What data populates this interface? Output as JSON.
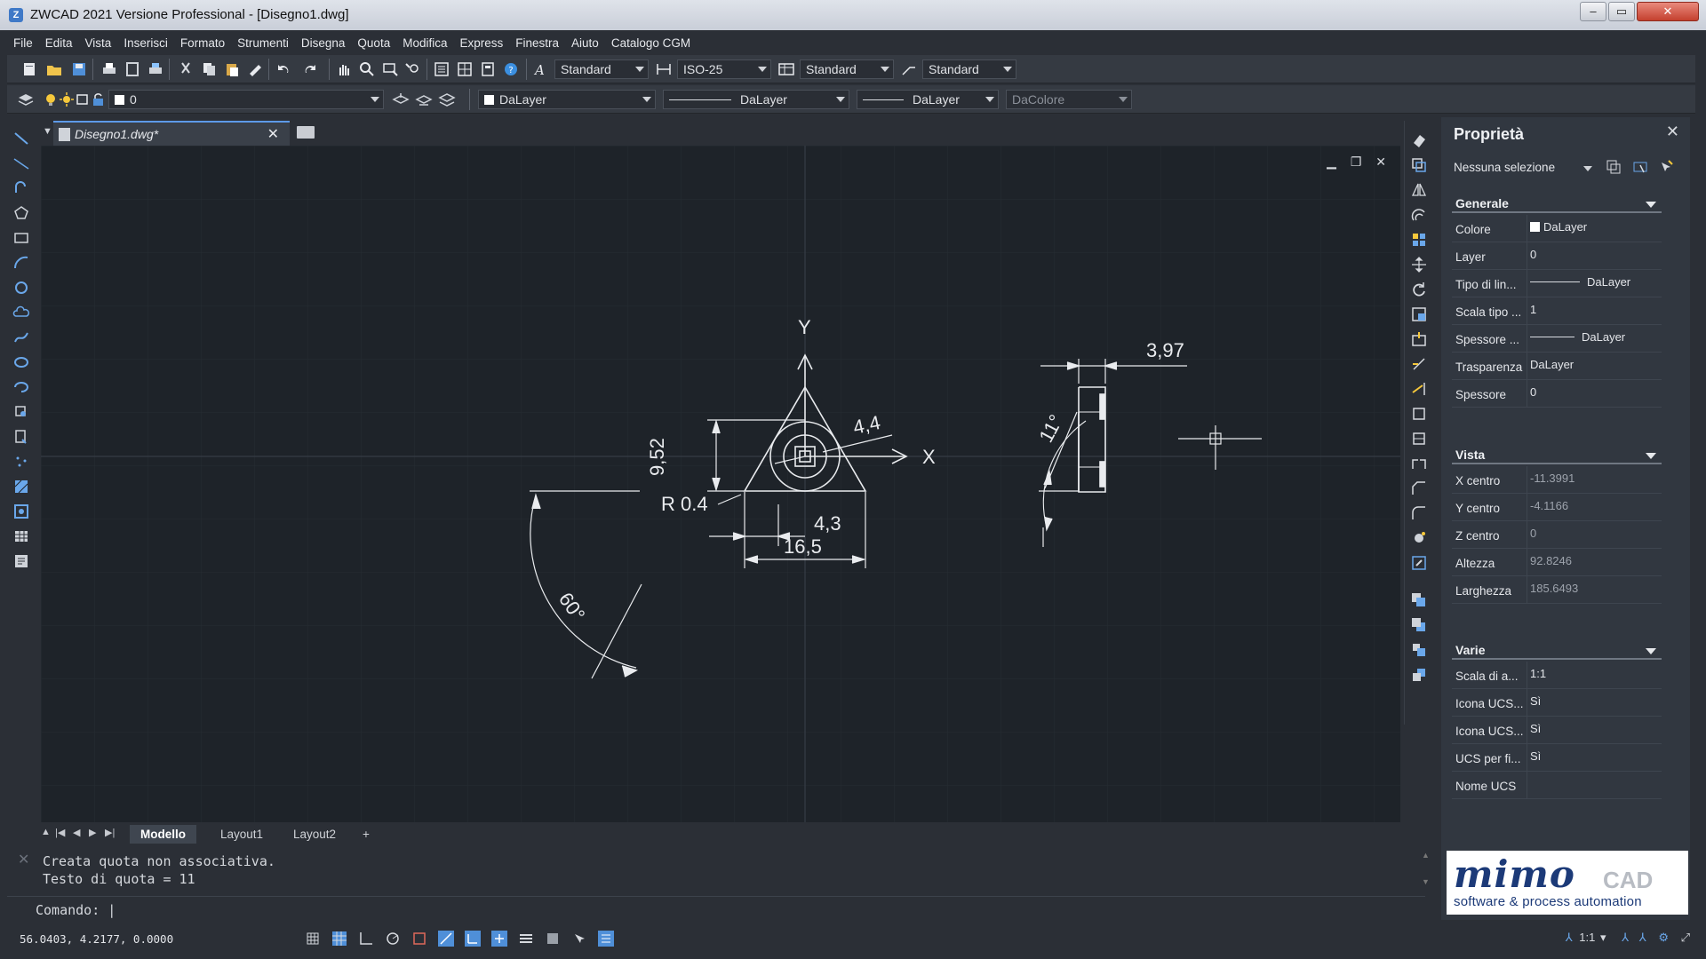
{
  "window": {
    "title": "ZWCAD 2021 Versione Professional - [Disegno1.dwg]",
    "controls": {
      "minimize": "–",
      "maximize": "▭",
      "close": "✕"
    }
  },
  "menu": [
    "File",
    "Edita",
    "Vista",
    "Inserisci",
    "Formato",
    "Strumenti",
    "Disegna",
    "Quota",
    "Modifica",
    "Express",
    "Finestra",
    "Aiuto",
    "Catalogo CGM"
  ],
  "toolbar": {
    "text_style": "Standard",
    "dim_style": "ISO-25",
    "table_style": "Standard",
    "multileader_style": "Standard",
    "layer": "0",
    "color": "DaLayer",
    "linetype": "DaLayer",
    "lineweight": "DaLayer",
    "plot_style": "DaColore"
  },
  "document_tab": {
    "label": "Disegno1.dwg*",
    "close": "✕"
  },
  "viewport_controls": {
    "minimize": "▁",
    "restore": "❐",
    "close": "✕"
  },
  "drawing": {
    "axis_x": "X",
    "axis_y": "Y",
    "dim_952": "9,52",
    "dim_44": "4,4",
    "dim_r04": "R 0.4",
    "dim_43": "4,3",
    "dim_165": "16,5",
    "dim_60": "60°",
    "dim_397": "3,97",
    "dim_11": "11°"
  },
  "layout_tabs": {
    "nav": [
      "▲",
      "|◀",
      "◀",
      "▶",
      "▶|"
    ],
    "tabs": [
      "Modello",
      "Layout1",
      "Layout2"
    ],
    "active": "Modello",
    "add": "+"
  },
  "command": {
    "history": [
      "Creata quota non associativa.",
      "Testo di quota = 11"
    ],
    "prompt": "Comando: |"
  },
  "status": {
    "coords": "56.0403, 4.2177, 0.0000",
    "scale": "1:1"
  },
  "properties": {
    "title": "Proprietà",
    "close": "✕",
    "selection": "Nessuna selezione",
    "sections": {
      "general": {
        "name": "Generale",
        "rows": [
          {
            "k": "Colore",
            "v": "DaLayer"
          },
          {
            "k": "Layer",
            "v": "0"
          },
          {
            "k": "Tipo di lin...",
            "v": "DaLayer"
          },
          {
            "k": "Scala tipo ...",
            "v": "1"
          },
          {
            "k": "Spessore ...",
            "v": "DaLayer"
          },
          {
            "k": "Trasparenza",
            "v": "DaLayer"
          },
          {
            "k": "Spessore",
            "v": "0"
          }
        ]
      },
      "view": {
        "name": "Vista",
        "rows": [
          {
            "k": "X centro",
            "v": "-11.3991"
          },
          {
            "k": "Y centro",
            "v": "-4.1166"
          },
          {
            "k": "Z centro",
            "v": "0"
          },
          {
            "k": "Altezza",
            "v": "92.8246"
          },
          {
            "k": "Larghezza",
            "v": "185.6493"
          }
        ]
      },
      "misc": {
        "name": "Varie",
        "rows": [
          {
            "k": "Scala di a...",
            "v": "1:1"
          },
          {
            "k": "Icona UCS...",
            "v": "Sì"
          },
          {
            "k": "Icona UCS...",
            "v": "Sì"
          },
          {
            "k": "UCS per fi...",
            "v": "Sì"
          },
          {
            "k": "Nome UCS",
            "v": ""
          }
        ]
      }
    }
  },
  "logo": {
    "brand": "mimo",
    "cad": "CAD",
    "tagline": "software & process automation"
  },
  "colors": {
    "accent": "#5d9ae8",
    "canvas": "#1e2329",
    "panel": "#313740",
    "brand": "#1c3a78"
  }
}
